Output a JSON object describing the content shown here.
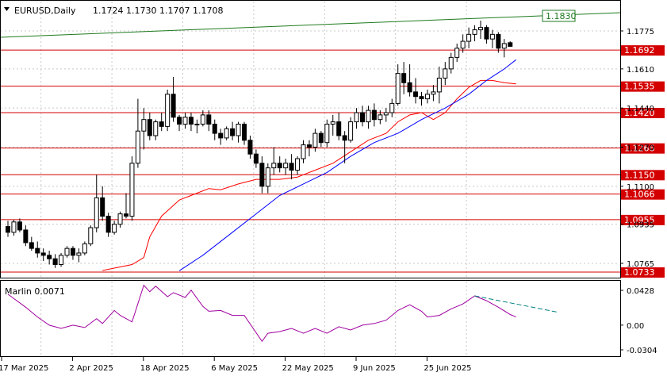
{
  "header": {
    "symbol_label": "EURUSD,Daily",
    "ohlc": "1.1724 1.1730 1.1707 1.1708"
  },
  "indicator": {
    "label": "Marlin 0.0071",
    "ticks": [
      "0.0428",
      "0.00",
      "-0.0304"
    ]
  },
  "colors": {
    "background": "#ffffff",
    "grid": "#c8c8c8",
    "level_line": "#d40000",
    "ma_fast": "#ff0000",
    "ma_slow": "#0000ff",
    "resistance": "#1e7a1e",
    "oscillator": "#a000a0",
    "oscillator_projection": "#008080"
  },
  "chart_data": {
    "type": "candlestick",
    "symbol": "EURUSD",
    "timeframe": "Daily",
    "y_ticks": [
      "1.1775",
      "1.1610",
      "1.1440",
      "1.1270",
      "1.1100",
      "1.0935",
      "1.0765"
    ],
    "x_ticks": [
      "17 Mar 2025",
      "2 Apr 2025",
      "18 Apr 2025",
      "6 May 2025",
      "22 May 2025",
      "9 Jun 2025",
      "25 Jun 2025"
    ],
    "ylim": [
      1.0733,
      1.19
    ],
    "levels": [
      {
        "label": "1.1692",
        "value": 1.1692
      },
      {
        "label": "1.1535",
        "value": 1.1535
      },
      {
        "label": "1.1420",
        "value": 1.142
      },
      {
        "label": "1.1266",
        "value": 1.1266
      },
      {
        "label": "1.1150",
        "value": 1.115
      },
      {
        "label": "1.1066",
        "value": 1.1066
      },
      {
        "label": "1.0955",
        "value": 1.0955
      },
      {
        "label": "1.0733",
        "value": 1.0733
      }
    ],
    "resistance_label": "1.1830",
    "candles": [
      [
        1.0925,
        1.095,
        1.088,
        1.09
      ],
      [
        1.09,
        1.0955,
        1.0885,
        1.0945
      ],
      [
        1.0945,
        1.096,
        1.09,
        1.091
      ],
      [
        1.091,
        1.093,
        1.084,
        1.0855
      ],
      [
        1.0855,
        1.088,
        1.082,
        1.083
      ],
      [
        1.083,
        1.086,
        1.079,
        1.081
      ],
      [
        1.081,
        1.083,
        1.0775,
        1.08
      ],
      [
        1.08,
        1.082,
        1.076,
        1.0785
      ],
      [
        1.0785,
        1.0805,
        1.0745,
        1.076
      ],
      [
        1.076,
        1.081,
        1.075,
        1.08
      ],
      [
        1.08,
        1.084,
        1.079,
        1.083
      ],
      [
        1.083,
        1.084,
        1.078,
        1.08
      ],
      [
        1.08,
        1.083,
        1.077,
        1.081
      ],
      [
        1.081,
        1.086,
        1.08,
        1.085
      ],
      [
        1.085,
        1.093,
        1.084,
        1.092
      ],
      [
        1.092,
        1.115,
        1.09,
        1.105
      ],
      [
        1.105,
        1.11,
        1.095,
        1.097
      ],
      [
        1.097,
        1.0985,
        1.088,
        1.09
      ],
      [
        1.09,
        1.095,
        1.089,
        1.0935
      ],
      [
        1.0935,
        1.099,
        1.092,
        1.098
      ],
      [
        1.098,
        1.107,
        1.096,
        1.097
      ],
      [
        1.097,
        1.123,
        1.095,
        1.12
      ],
      [
        1.12,
        1.148,
        1.118,
        1.134
      ],
      [
        1.134,
        1.144,
        1.126,
        1.139
      ],
      [
        1.139,
        1.142,
        1.13,
        1.132
      ],
      [
        1.132,
        1.139,
        1.13,
        1.138
      ],
      [
        1.138,
        1.142,
        1.134,
        1.136
      ],
      [
        1.136,
        1.152,
        1.134,
        1.15
      ],
      [
        1.15,
        1.1575,
        1.138,
        1.14
      ],
      [
        1.14,
        1.141,
        1.134,
        1.137
      ],
      [
        1.137,
        1.142,
        1.135,
        1.14
      ],
      [
        1.14,
        1.142,
        1.134,
        1.137
      ],
      [
        1.137,
        1.139,
        1.133,
        1.137
      ],
      [
        1.137,
        1.143,
        1.136,
        1.141
      ],
      [
        1.141,
        1.143,
        1.134,
        1.137
      ],
      [
        1.137,
        1.139,
        1.13,
        1.133
      ],
      [
        1.133,
        1.135,
        1.128,
        1.131
      ],
      [
        1.131,
        1.136,
        1.13,
        1.135
      ],
      [
        1.135,
        1.138,
        1.13,
        1.132
      ],
      [
        1.132,
        1.138,
        1.129,
        1.137
      ],
      [
        1.137,
        1.138,
        1.128,
        1.13
      ],
      [
        1.13,
        1.132,
        1.122,
        1.124
      ],
      [
        1.124,
        1.126,
        1.118,
        1.12
      ],
      [
        1.12,
        1.123,
        1.107,
        1.11
      ],
      [
        1.11,
        1.12,
        1.107,
        1.118
      ],
      [
        1.118,
        1.127,
        1.115,
        1.12
      ],
      [
        1.12,
        1.123,
        1.116,
        1.118
      ],
      [
        1.118,
        1.122,
        1.115,
        1.12
      ],
      [
        1.12,
        1.124,
        1.113,
        1.117
      ],
      [
        1.117,
        1.123,
        1.115,
        1.122
      ],
      [
        1.122,
        1.13,
        1.12,
        1.128
      ],
      [
        1.128,
        1.13,
        1.123,
        1.127
      ],
      [
        1.127,
        1.135,
        1.125,
        1.133
      ],
      [
        1.133,
        1.134,
        1.127,
        1.129
      ],
      [
        1.129,
        1.139,
        1.127,
        1.137
      ],
      [
        1.137,
        1.141,
        1.132,
        1.138
      ],
      [
        1.138,
        1.142,
        1.13,
        1.132
      ],
      [
        1.132,
        1.134,
        1.12,
        1.13
      ],
      [
        1.13,
        1.14,
        1.129,
        1.138
      ],
      [
        1.138,
        1.144,
        1.135,
        1.142
      ],
      [
        1.142,
        1.145,
        1.136,
        1.138
      ],
      [
        1.138,
        1.145,
        1.135,
        1.143
      ],
      [
        1.143,
        1.146,
        1.136,
        1.139
      ],
      [
        1.139,
        1.143,
        1.137,
        1.141
      ],
      [
        1.141,
        1.144,
        1.138,
        1.142
      ],
      [
        1.142,
        1.148,
        1.14,
        1.146
      ],
      [
        1.146,
        1.163,
        1.145,
        1.159
      ],
      [
        1.159,
        1.164,
        1.15,
        1.155
      ],
      [
        1.155,
        1.163,
        1.149,
        1.151
      ],
      [
        1.151,
        1.157,
        1.146,
        1.149
      ],
      [
        1.149,
        1.151,
        1.145,
        1.148
      ],
      [
        1.148,
        1.152,
        1.146,
        1.15
      ],
      [
        1.15,
        1.154,
        1.147,
        1.151
      ],
      [
        1.151,
        1.162,
        1.146,
        1.157
      ],
      [
        1.157,
        1.164,
        1.154,
        1.161
      ],
      [
        1.161,
        1.168,
        1.159,
        1.166
      ],
      [
        1.166,
        1.172,
        1.164,
        1.17
      ],
      [
        1.17,
        1.176,
        1.168,
        1.173
      ],
      [
        1.173,
        1.179,
        1.17,
        1.176
      ],
      [
        1.176,
        1.18,
        1.173,
        1.178
      ],
      [
        1.178,
        1.182,
        1.174,
        1.179
      ],
      [
        1.179,
        1.18,
        1.172,
        1.174
      ],
      [
        1.174,
        1.178,
        1.17,
        1.176
      ],
      [
        1.176,
        1.177,
        1.168,
        1.17
      ],
      [
        1.17,
        1.174,
        1.166,
        1.172
      ],
      [
        1.1724,
        1.173,
        1.1707,
        1.1708
      ]
    ],
    "ma_fast": [
      [
        16,
        1.0734
      ],
      [
        21,
        1.076
      ],
      [
        23,
        1.079
      ],
      [
        24,
        1.088
      ],
      [
        26,
        1.097
      ],
      [
        29,
        1.104
      ],
      [
        31,
        1.106
      ],
      [
        34,
        1.109
      ],
      [
        36,
        1.1085
      ],
      [
        39,
        1.111
      ],
      [
        42,
        1.113
      ],
      [
        46,
        1.113
      ],
      [
        49,
        1.114
      ],
      [
        52,
        1.117
      ],
      [
        55,
        1.12
      ],
      [
        58,
        1.125
      ],
      [
        61,
        1.13
      ],
      [
        64,
        1.133
      ],
      [
        66,
        1.138
      ],
      [
        68,
        1.141
      ],
      [
        70,
        1.142
      ],
      [
        72,
        1.139
      ],
      [
        74,
        1.142
      ],
      [
        76,
        1.148
      ],
      [
        78,
        1.153
      ],
      [
        80,
        1.156
      ],
      [
        82,
        1.156
      ],
      [
        84,
        1.155
      ],
      [
        86,
        1.1545
      ]
    ],
    "ma_slow": [
      [
        29,
        1.0733
      ],
      [
        33,
        1.08
      ],
      [
        38,
        1.09
      ],
      [
        42,
        1.098
      ],
      [
        46,
        1.106
      ],
      [
        50,
        1.111
      ],
      [
        54,
        1.116
      ],
      [
        58,
        1.123
      ],
      [
        62,
        1.129
      ],
      [
        66,
        1.133
      ],
      [
        70,
        1.139
      ],
      [
        74,
        1.144
      ],
      [
        78,
        1.15
      ],
      [
        81,
        1.156
      ],
      [
        84,
        1.161
      ],
      [
        86,
        1.165
      ]
    ],
    "oscillator": [
      [
        0,
        0.038
      ],
      [
        3,
        0.022
      ],
      [
        5,
        0.01
      ],
      [
        7,
        0.0
      ],
      [
        9,
        -0.004
      ],
      [
        11,
        0.0
      ],
      [
        13,
        -0.003
      ],
      [
        15,
        0.008
      ],
      [
        16,
        0.002
      ],
      [
        18,
        0.018
      ],
      [
        19,
        0.012
      ],
      [
        21,
        0.004
      ],
      [
        23,
        0.049
      ],
      [
        24,
        0.041
      ],
      [
        25,
        0.048
      ],
      [
        27,
        0.035
      ],
      [
        28,
        0.04
      ],
      [
        30,
        0.034
      ],
      [
        31,
        0.043
      ],
      [
        33,
        0.023
      ],
      [
        34,
        0.017
      ],
      [
        36,
        0.018
      ],
      [
        38,
        0.012
      ],
      [
        40,
        0.012
      ],
      [
        43,
        -0.02
      ],
      [
        44,
        -0.01
      ],
      [
        46,
        -0.008
      ],
      [
        48,
        -0.004
      ],
      [
        50,
        -0.01
      ],
      [
        52,
        -0.004
      ],
      [
        54,
        -0.01
      ],
      [
        56,
        -0.002
      ],
      [
        58,
        -0.006
      ],
      [
        60,
        0.0
      ],
      [
        62,
        0.002
      ],
      [
        64,
        0.006
      ],
      [
        66,
        0.018
      ],
      [
        68,
        0.025
      ],
      [
        70,
        0.017
      ],
      [
        71,
        0.01
      ],
      [
        73,
        0.012
      ],
      [
        75,
        0.02
      ],
      [
        77,
        0.026
      ],
      [
        79,
        0.036
      ],
      [
        81,
        0.03
      ],
      [
        83,
        0.022
      ],
      [
        85,
        0.013
      ],
      [
        86,
        0.01
      ]
    ],
    "oscillator_projection": [
      [
        79,
        0.036
      ],
      [
        93,
        0.016
      ]
    ]
  }
}
